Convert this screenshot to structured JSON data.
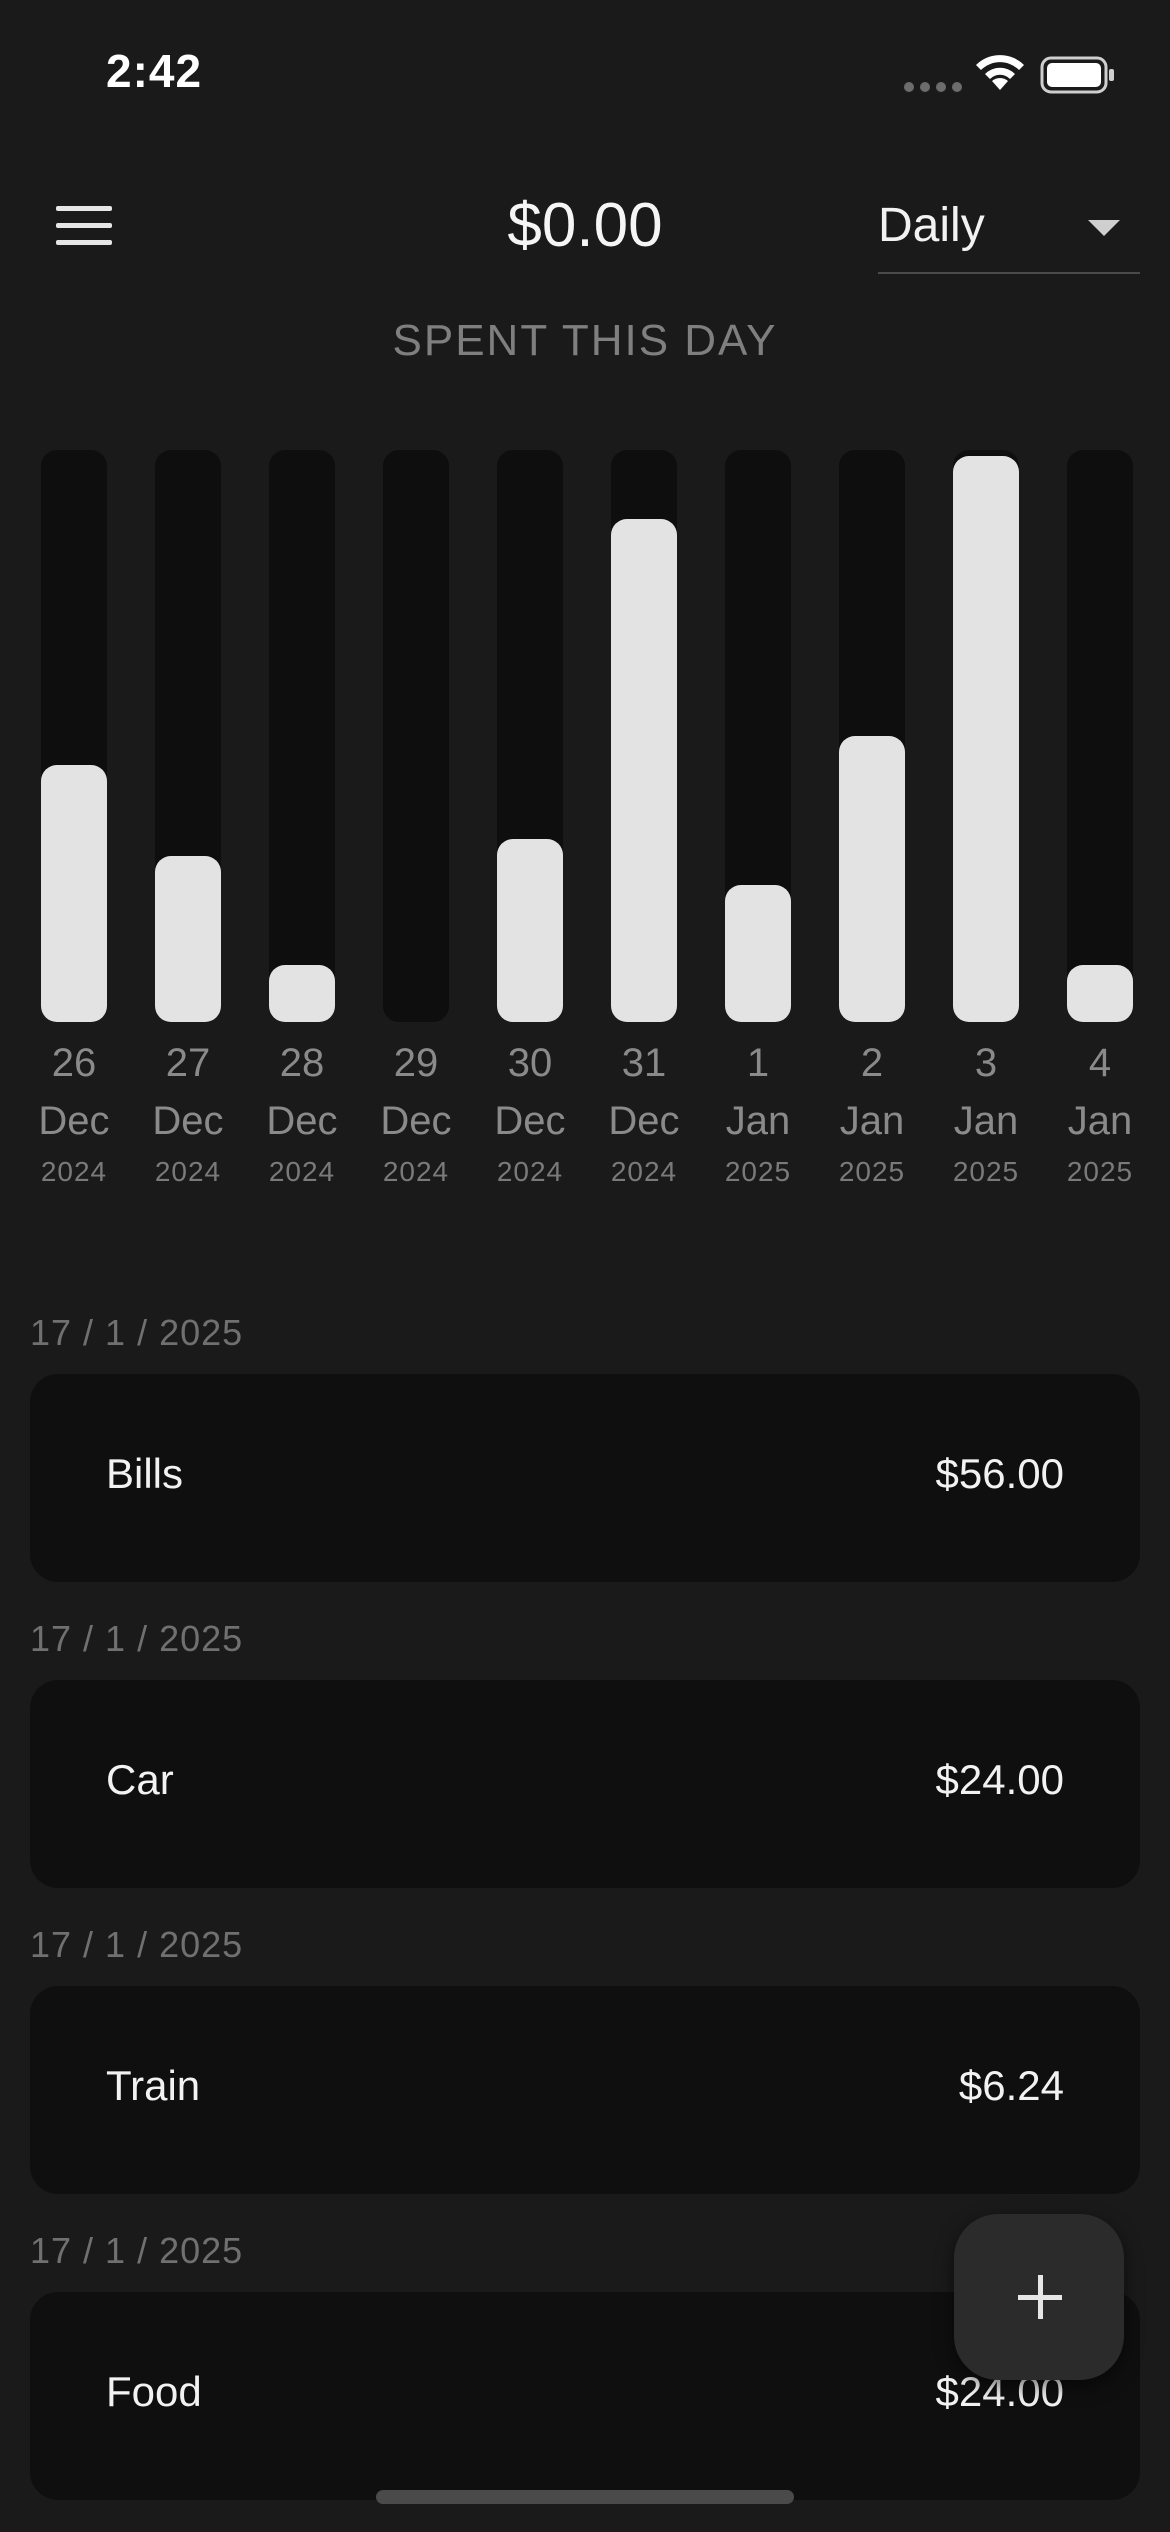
{
  "status_bar": {
    "time": "2:42"
  },
  "header": {
    "total": "$0.00",
    "period": "Daily",
    "subtitle": "SPENT THIS DAY"
  },
  "chart_data": {
    "type": "bar",
    "categories": [
      {
        "day": "26",
        "month": "Dec",
        "year": "2024"
      },
      {
        "day": "27",
        "month": "Dec",
        "year": "2024"
      },
      {
        "day": "28",
        "month": "Dec",
        "year": "2024"
      },
      {
        "day": "29",
        "month": "Dec",
        "year": "2024"
      },
      {
        "day": "30",
        "month": "Dec",
        "year": "2024"
      },
      {
        "day": "31",
        "month": "Dec",
        "year": "2024"
      },
      {
        "day": "1",
        "month": "Jan",
        "year": "2025"
      },
      {
        "day": "2",
        "month": "Jan",
        "year": "2025"
      },
      {
        "day": "3",
        "month": "Jan",
        "year": "2025"
      },
      {
        "day": "4",
        "month": "Jan",
        "year": "2025"
      }
    ],
    "values": [
      0.45,
      0.29,
      0.1,
      0.0,
      0.32,
      0.88,
      0.24,
      0.5,
      0.99,
      0.1
    ],
    "ylim": [
      0,
      1
    ],
    "bar_color": "#e3e3e3",
    "track_color": "#0e0e0e"
  },
  "entries": [
    {
      "date": "17 / 1 / 2025",
      "category": "Bills",
      "amount": "$56.00"
    },
    {
      "date": "17 / 1 / 2025",
      "category": "Car",
      "amount": "$24.00"
    },
    {
      "date": "17 / 1 / 2025",
      "category": "Train",
      "amount": "$6.24"
    },
    {
      "date": "17 / 1 / 2025",
      "category": "Food",
      "amount": "$24.00"
    }
  ],
  "icons": {
    "menu": "menu-icon",
    "wifi": "wifi-icon",
    "battery": "battery-icon",
    "dropdown": "caret-down-icon",
    "add": "plus-icon"
  },
  "colors": {
    "background": "#1a1a1b",
    "card": "#0f0f0f",
    "fab": "#2b2b2c"
  }
}
